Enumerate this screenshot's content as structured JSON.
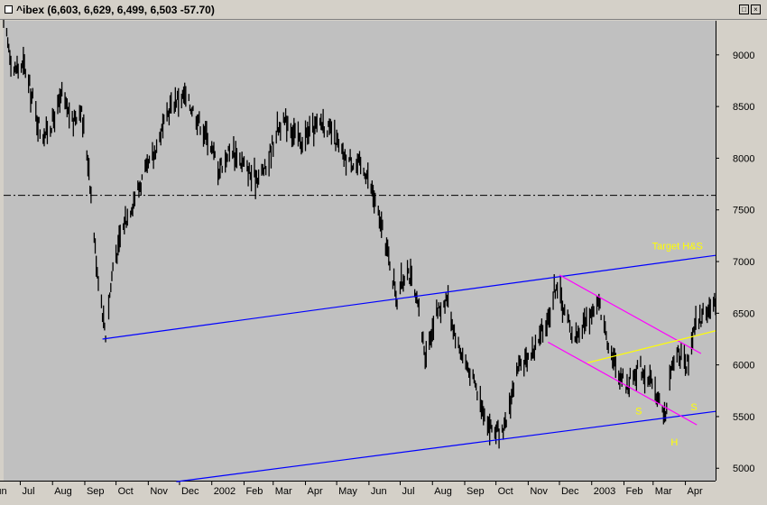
{
  "window": {
    "title": "^ibex (6,603, 6,629, 6,499, 6,503 -57.70)",
    "restore_glyph": "□",
    "close_glyph": "×"
  },
  "chart_data": {
    "type": "candlestick",
    "instrument": "^ibex",
    "last_bar": {
      "open": 6603,
      "high": 6629,
      "low": 6499,
      "close": 6503,
      "change": -57.7
    },
    "y_axis": {
      "ticks": [
        9000,
        8500,
        8000,
        7500,
        7000,
        6500,
        6000,
        5500,
        5000
      ],
      "range": [
        4880,
        9330
      ],
      "side": "right"
    },
    "x_axis": {
      "range": [
        "2001-06-15",
        "2003-04-30"
      ],
      "ticks": [
        {
          "date": "2001-06-01",
          "label": "Jun"
        },
        {
          "date": "2001-07-01",
          "label": "Jul"
        },
        {
          "date": "2001-08-01",
          "label": "Aug"
        },
        {
          "date": "2001-09-01",
          "label": "Sep"
        },
        {
          "date": "2001-10-01",
          "label": "Oct"
        },
        {
          "date": "2001-11-01",
          "label": "Nov"
        },
        {
          "date": "2001-12-01",
          "label": "Dec"
        },
        {
          "date": "2002-01-01",
          "label": "2002"
        },
        {
          "date": "2002-02-01",
          "label": "Feb"
        },
        {
          "date": "2002-03-01",
          "label": "Mar"
        },
        {
          "date": "2002-04-01",
          "label": "Apr"
        },
        {
          "date": "2002-05-01",
          "label": "May"
        },
        {
          "date": "2002-06-01",
          "label": "Jun"
        },
        {
          "date": "2002-07-01",
          "label": "Jul"
        },
        {
          "date": "2002-08-01",
          "label": "Aug"
        },
        {
          "date": "2002-09-01",
          "label": "Sep"
        },
        {
          "date": "2002-10-01",
          "label": "Oct"
        },
        {
          "date": "2002-11-01",
          "label": "Nov"
        },
        {
          "date": "2002-12-01",
          "label": "Dec"
        },
        {
          "date": "2003-01-01",
          "label": "2003"
        },
        {
          "date": "2003-02-01",
          "label": "Feb"
        },
        {
          "date": "2003-03-01",
          "label": "Mar"
        },
        {
          "date": "2003-04-01",
          "label": "Apr"
        }
      ]
    },
    "price_path": [
      [
        "2001-06-15",
        9300
      ],
      [
        "2001-06-25",
        8850
      ],
      [
        "2001-07-05",
        8900
      ],
      [
        "2001-07-12",
        8600
      ],
      [
        "2001-07-22",
        8200
      ],
      [
        "2001-08-01",
        8350
      ],
      [
        "2001-08-10",
        8600
      ],
      [
        "2001-08-20",
        8350
      ],
      [
        "2001-08-28",
        8500
      ],
      [
        "2001-09-05",
        7900
      ],
      [
        "2001-09-12",
        7000
      ],
      [
        "2001-09-21",
        6300
      ],
      [
        "2001-09-28",
        6950
      ],
      [
        "2001-10-10",
        7400
      ],
      [
        "2001-10-22",
        7700
      ],
      [
        "2001-11-05",
        8000
      ],
      [
        "2001-11-15",
        8300
      ],
      [
        "2001-11-25",
        8550
      ],
      [
        "2001-12-05",
        8600
      ],
      [
        "2001-12-15",
        8450
      ],
      [
        "2001-12-28",
        8200
      ],
      [
        "2002-01-08",
        7900
      ],
      [
        "2002-01-20",
        8100
      ],
      [
        "2002-01-30",
        7950
      ],
      [
        "2002-02-10",
        7800
      ],
      [
        "2002-02-22",
        7900
      ],
      [
        "2002-03-05",
        8300
      ],
      [
        "2002-03-15",
        8350
      ],
      [
        "2002-03-28",
        8150
      ],
      [
        "2002-04-08",
        8300
      ],
      [
        "2002-04-18",
        8350
      ],
      [
        "2002-04-28",
        8200
      ],
      [
        "2002-05-08",
        8000
      ],
      [
        "2002-05-20",
        7950
      ],
      [
        "2002-05-30",
        7850
      ],
      [
        "2002-06-10",
        7450
      ],
      [
        "2002-06-20",
        7050
      ],
      [
        "2002-06-28",
        6650
      ],
      [
        "2002-07-08",
        6950
      ],
      [
        "2002-07-18",
        6550
      ],
      [
        "2002-07-25",
        6100
      ],
      [
        "2002-08-05",
        6500
      ],
      [
        "2002-08-15",
        6650
      ],
      [
        "2002-08-25",
        6200
      ],
      [
        "2002-09-05",
        5950
      ],
      [
        "2002-09-15",
        5700
      ],
      [
        "2002-09-25",
        5400
      ],
      [
        "2002-10-08",
        5300
      ],
      [
        "2002-10-20",
        5900
      ],
      [
        "2002-10-30",
        6050
      ],
      [
        "2002-11-10",
        6200
      ],
      [
        "2002-11-20",
        6450
      ],
      [
        "2002-11-28",
        6800
      ],
      [
        "2002-12-05",
        6550
      ],
      [
        "2002-12-15",
        6250
      ],
      [
        "2002-12-28",
        6450
      ],
      [
        "2003-01-08",
        6600
      ],
      [
        "2003-01-15",
        6300
      ],
      [
        "2003-01-25",
        5950
      ],
      [
        "2003-02-05",
        5800
      ],
      [
        "2003-02-15",
        6000
      ],
      [
        "2003-02-25",
        5850
      ],
      [
        "2003-03-05",
        5700
      ],
      [
        "2003-03-12",
        5500
      ],
      [
        "2003-03-18",
        5900
      ],
      [
        "2003-03-25",
        6150
      ],
      [
        "2003-04-02",
        5950
      ],
      [
        "2003-04-10",
        6350
      ],
      [
        "2003-04-22",
        6550
      ],
      [
        "2003-04-30",
        6550
      ]
    ],
    "reference_lines": [
      {
        "name": "horizontal-level",
        "style": "dash-dot",
        "color": "#000000",
        "value": 7640
      },
      {
        "name": "upper-channel",
        "style": "solid",
        "color": "#0000ff",
        "from": [
          "2001-09-18",
          6250
        ],
        "to": [
          "2003-04-30",
          7060
        ]
      },
      {
        "name": "lower-channel",
        "style": "solid",
        "color": "#0000ff",
        "from": [
          "2001-11-28",
          4870
        ],
        "to": [
          "2003-04-30",
          5550
        ]
      },
      {
        "name": "downtrend-upper",
        "style": "solid",
        "color": "#ff00ff",
        "from": [
          "2002-12-01",
          6870
        ],
        "to": [
          "2003-04-16",
          6110
        ]
      },
      {
        "name": "downtrend-lower",
        "style": "solid",
        "color": "#ff00ff",
        "from": [
          "2002-11-20",
          6220
        ],
        "to": [
          "2003-04-12",
          5420
        ]
      },
      {
        "name": "neckline",
        "style": "solid",
        "color": "#ffff00",
        "from": [
          "2002-12-28",
          6020
        ],
        "to": [
          "2003-04-30",
          6330
        ]
      }
    ],
    "annotations": [
      {
        "text": "Target H&S",
        "color": "#ffff00",
        "at": [
          "2003-02-28",
          7120
        ]
      },
      {
        "text": "S",
        "color": "#ffff00",
        "at": [
          "2003-02-12",
          5520
        ]
      },
      {
        "text": "H",
        "color": "#ffff00",
        "at": [
          "2003-03-18",
          5220
        ]
      },
      {
        "text": "S",
        "color": "#ffff00",
        "at": [
          "2003-04-06",
          5560
        ]
      }
    ],
    "colors": {
      "background": "#c0c0c0",
      "bars": "#000000",
      "panel": "#d4d0c8"
    },
    "grid": false,
    "legend": "none"
  }
}
